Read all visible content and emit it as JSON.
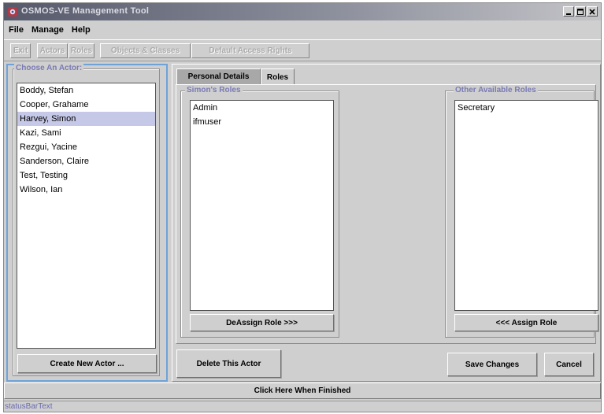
{
  "window": {
    "title": "OSMOS-VE Management Tool",
    "controls": [
      "minimize-icon",
      "maximize-icon",
      "close-icon"
    ]
  },
  "menubar": {
    "items": [
      "File",
      "Manage",
      "Help"
    ]
  },
  "toolbar": {
    "buttons": [
      "Exit",
      "Actors",
      "Roles",
      "Objects & Classes",
      "Default Access Rights"
    ]
  },
  "actor_panel": {
    "title": "Choose An Actor:",
    "actors": [
      "Boddy, Stefan",
      "Cooper, Grahame",
      "Harvey, Simon",
      "Kazi, Sami",
      "Rezgui, Yacine",
      "Sanderson, Claire",
      "Test, Testing",
      "Wilson, Ian"
    ],
    "selected_index": 2,
    "create_button": "Create New Actor ..."
  },
  "tabs": [
    {
      "label": "Personal Details",
      "active": false
    },
    {
      "label": "Roles",
      "active": true
    }
  ],
  "roles": {
    "assigned_title": "Simon's Roles",
    "assigned": [
      "Admin",
      "ifmuser"
    ],
    "deassign_button": "DeAssign Role >>>",
    "available_title": "Other Available Roles",
    "available": [
      "Secretary"
    ],
    "assign_button": "<<< Assign Role"
  },
  "actions": {
    "delete": "Delete This Actor",
    "save": "Save Changes",
    "cancel": "Cancel"
  },
  "finish_button": "Click Here When Finished",
  "status_text": "statusBarText",
  "colors": {
    "selection": "#c5c8e7",
    "focus_border": "#6fa3d8",
    "legend_text": "#7a7ab4",
    "panel_bg": "#cfcfcf"
  }
}
